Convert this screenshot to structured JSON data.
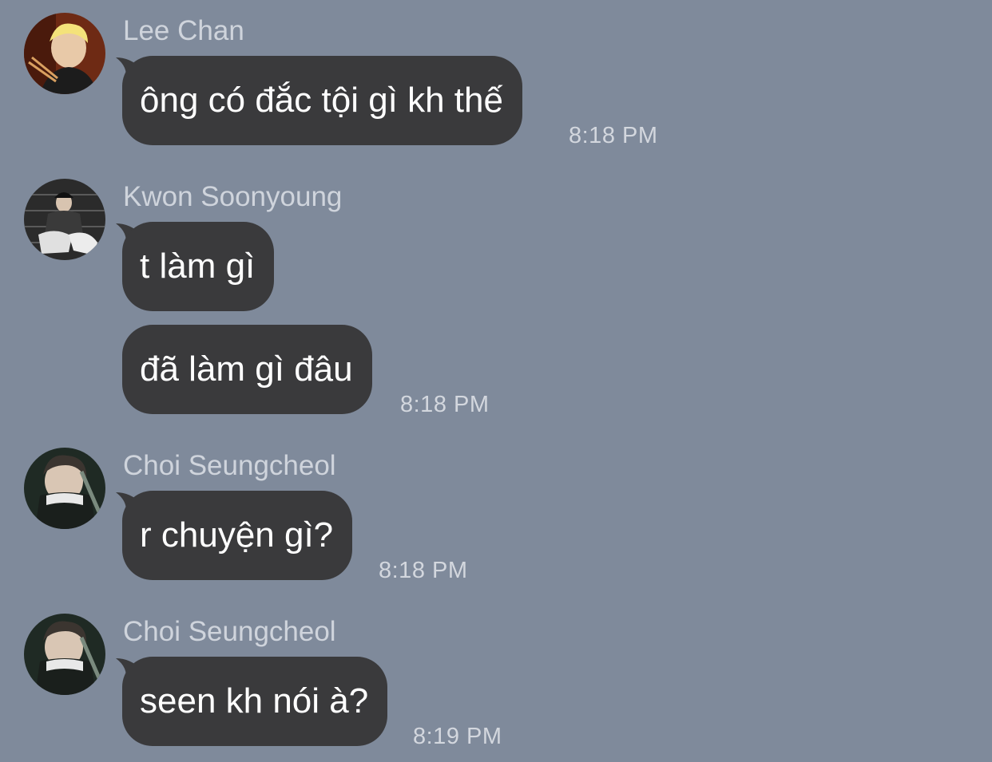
{
  "messages": [
    {
      "sender": "Lee Chan",
      "avatar_icon": "profile-photo-blond-man-with-chopsticks",
      "bubbles": [
        "ông có đắc tội gì kh thế"
      ],
      "time": "8:18 PM"
    },
    {
      "sender": "Kwon Soonyoung",
      "avatar_icon": "profile-photo-man-sitting-on-stairs",
      "bubbles": [
        "t làm gì",
        "đã làm gì đâu"
      ],
      "time": "8:18 PM"
    },
    {
      "sender": "Choi Seungcheol",
      "avatar_icon": "profile-photo-man-with-zipped-jacket",
      "bubbles": [
        "r chuyện gì?"
      ],
      "time": "8:18 PM"
    },
    {
      "sender": "Choi Seungcheol",
      "avatar_icon": "profile-photo-man-with-zipped-jacket",
      "bubbles": [
        "seen kh nói à?"
      ],
      "time": "8:19 PM"
    }
  ],
  "colors": {
    "background": "#7f8a9b",
    "bubble": "#3a3a3c",
    "bubble_text": "#ffffff",
    "meta_text": "#d3d7de"
  }
}
